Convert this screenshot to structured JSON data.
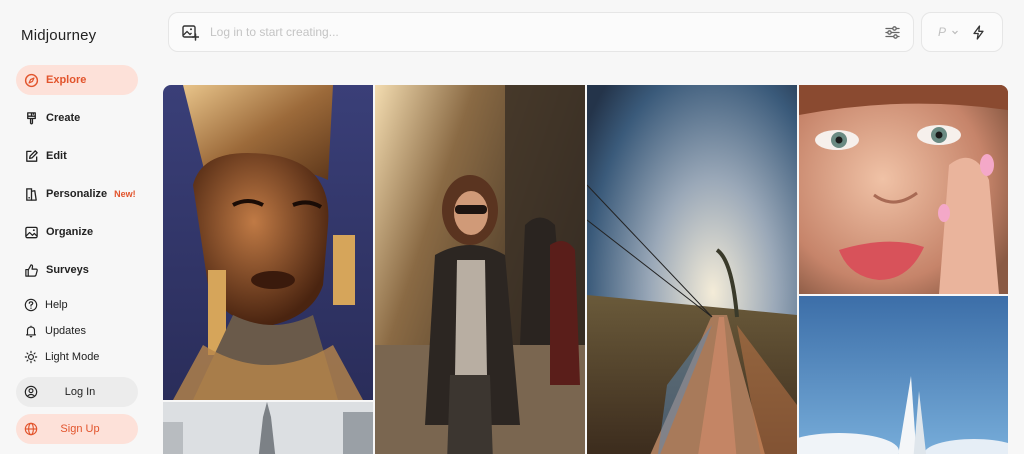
{
  "sidebar": {
    "brand": "Midjourney",
    "nav": [
      {
        "label": "Explore",
        "icon": "compass-icon",
        "active": true
      },
      {
        "label": "Create",
        "icon": "brush-icon"
      },
      {
        "label": "Edit",
        "icon": "edit-icon"
      },
      {
        "label": "Personalize",
        "icon": "personalize-icon",
        "badge": "New!"
      },
      {
        "label": "Organize",
        "icon": "image-icon"
      },
      {
        "label": "Surveys",
        "icon": "thumbs-up-icon"
      }
    ],
    "secondary": [
      {
        "label": "Help",
        "icon": "help-icon"
      },
      {
        "label": "Updates",
        "icon": "bell-icon"
      },
      {
        "label": "Light Mode",
        "icon": "sun-icon"
      }
    ],
    "login_label": "Log In",
    "signup_label": "Sign Up"
  },
  "search": {
    "placeholder": "Log in to start creating..."
  },
  "toolbox": {
    "p_label": "P"
  },
  "colors": {
    "accent": "#e2542c",
    "accent_bg": "#fde1d9"
  },
  "gallery": [
    {
      "name": "gallery-image-gold-headdress-portrait"
    },
    {
      "name": "gallery-image-city-street-woman"
    },
    {
      "name": "gallery-image-motion-blur-sky-road"
    },
    {
      "name": "gallery-image-freckled-face-closeup"
    },
    {
      "name": "gallery-image-tower-rain"
    },
    {
      "name": "gallery-image-sailboat-sky"
    }
  ]
}
